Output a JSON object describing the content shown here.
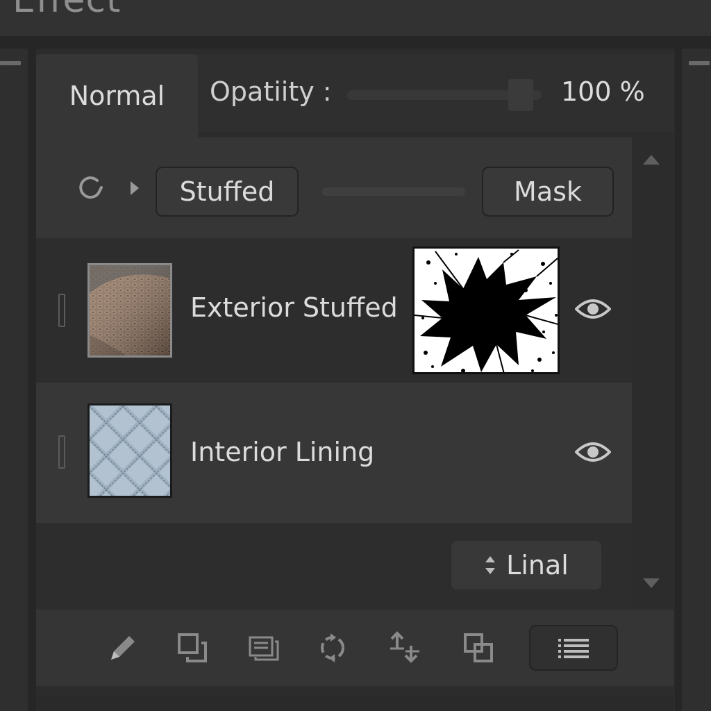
{
  "window": {
    "title": "Effect"
  },
  "blend": {
    "mode": "Normal",
    "opacity_label": "Opatiity :",
    "opacity_value": "100 %",
    "opacity_fraction": 0.95
  },
  "group": {
    "stuffed_label": "Stuffed",
    "mask_label": "Mask"
  },
  "layers": [
    {
      "name": "Exterior Stuffed",
      "thumbnail": "knit-texture",
      "has_mask": true,
      "visible": true
    },
    {
      "name": "Interior Lining",
      "thumbnail": "quilted-texture",
      "has_mask": false,
      "visible": true
    }
  ],
  "footer": {
    "linal_label": "Linal",
    "linal_icon": "up-down-icon"
  },
  "toolbar": {
    "tools": [
      "pencil-icon",
      "duplicate-icon",
      "layers-stack-icon",
      "rotate-icon",
      "move-icon",
      "arrange-icon"
    ],
    "menu_icon": "list-icon"
  },
  "colors": {
    "panel": "#2c2c2c",
    "row_active": "#373737",
    "text": "#dcdcdc",
    "knit": "#8a6f5a",
    "quilt": "#9aaabb"
  }
}
